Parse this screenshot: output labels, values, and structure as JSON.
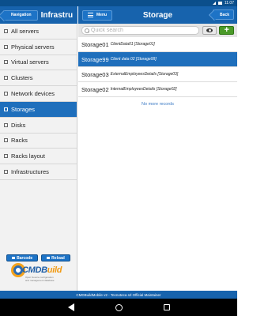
{
  "status_bar": {
    "time": "11:07"
  },
  "left_header": {
    "nav_button": "Navigation",
    "title": "Infrastructure"
  },
  "right_header": {
    "menu_button": "Menu",
    "title": "Storage",
    "back_button": "Back"
  },
  "sidebar": {
    "items": [
      {
        "label": "All servers",
        "icon": "folder-icon",
        "active": false
      },
      {
        "label": "Physical servers",
        "icon": "folder-icon",
        "active": false
      },
      {
        "label": "Virtual servers",
        "icon": "folder-icon",
        "active": false
      },
      {
        "label": "Clusters",
        "icon": "folder-icon",
        "active": false
      },
      {
        "label": "Network devices",
        "icon": "folder-icon",
        "active": false
      },
      {
        "label": "Storages",
        "icon": "folder-icon",
        "active": true
      },
      {
        "label": "Disks",
        "icon": "folder-icon",
        "active": false
      },
      {
        "label": "Racks",
        "icon": "folder-icon",
        "active": false
      },
      {
        "label": "Racks layout",
        "icon": "layout-icon",
        "active": false
      },
      {
        "label": "Infrastructures",
        "icon": "folder-icon",
        "active": false
      }
    ],
    "barcode_button": "Barcode",
    "reload_button": "Reload",
    "logo": {
      "brand": "CMDBuild",
      "tagline1": "Open Source configuration",
      "tagline2": "and management database"
    }
  },
  "search": {
    "placeholder": "Quick search",
    "value": ""
  },
  "records": [
    {
      "code": "Storage01",
      "description": "ClientData01 [Storage01]",
      "selected": false
    },
    {
      "code": "Storage99",
      "description": "Client data 02 [Storage99]",
      "selected": true
    },
    {
      "code": "Storage03",
      "description": "ExternalEmployeesDetails [Storage03]",
      "selected": false
    },
    {
      "code": "Storage02",
      "description": "InternalEmployeesDetails [Storage02]",
      "selected": false
    }
  ],
  "no_more_records": "No more records",
  "footer": {
    "text": "CMDBuildMobile v2 - Tecnoteca srl Official Maintainer"
  },
  "colors": {
    "accent": "#1f6fbc",
    "header": "#1763ad",
    "add": "#4a9a28"
  }
}
